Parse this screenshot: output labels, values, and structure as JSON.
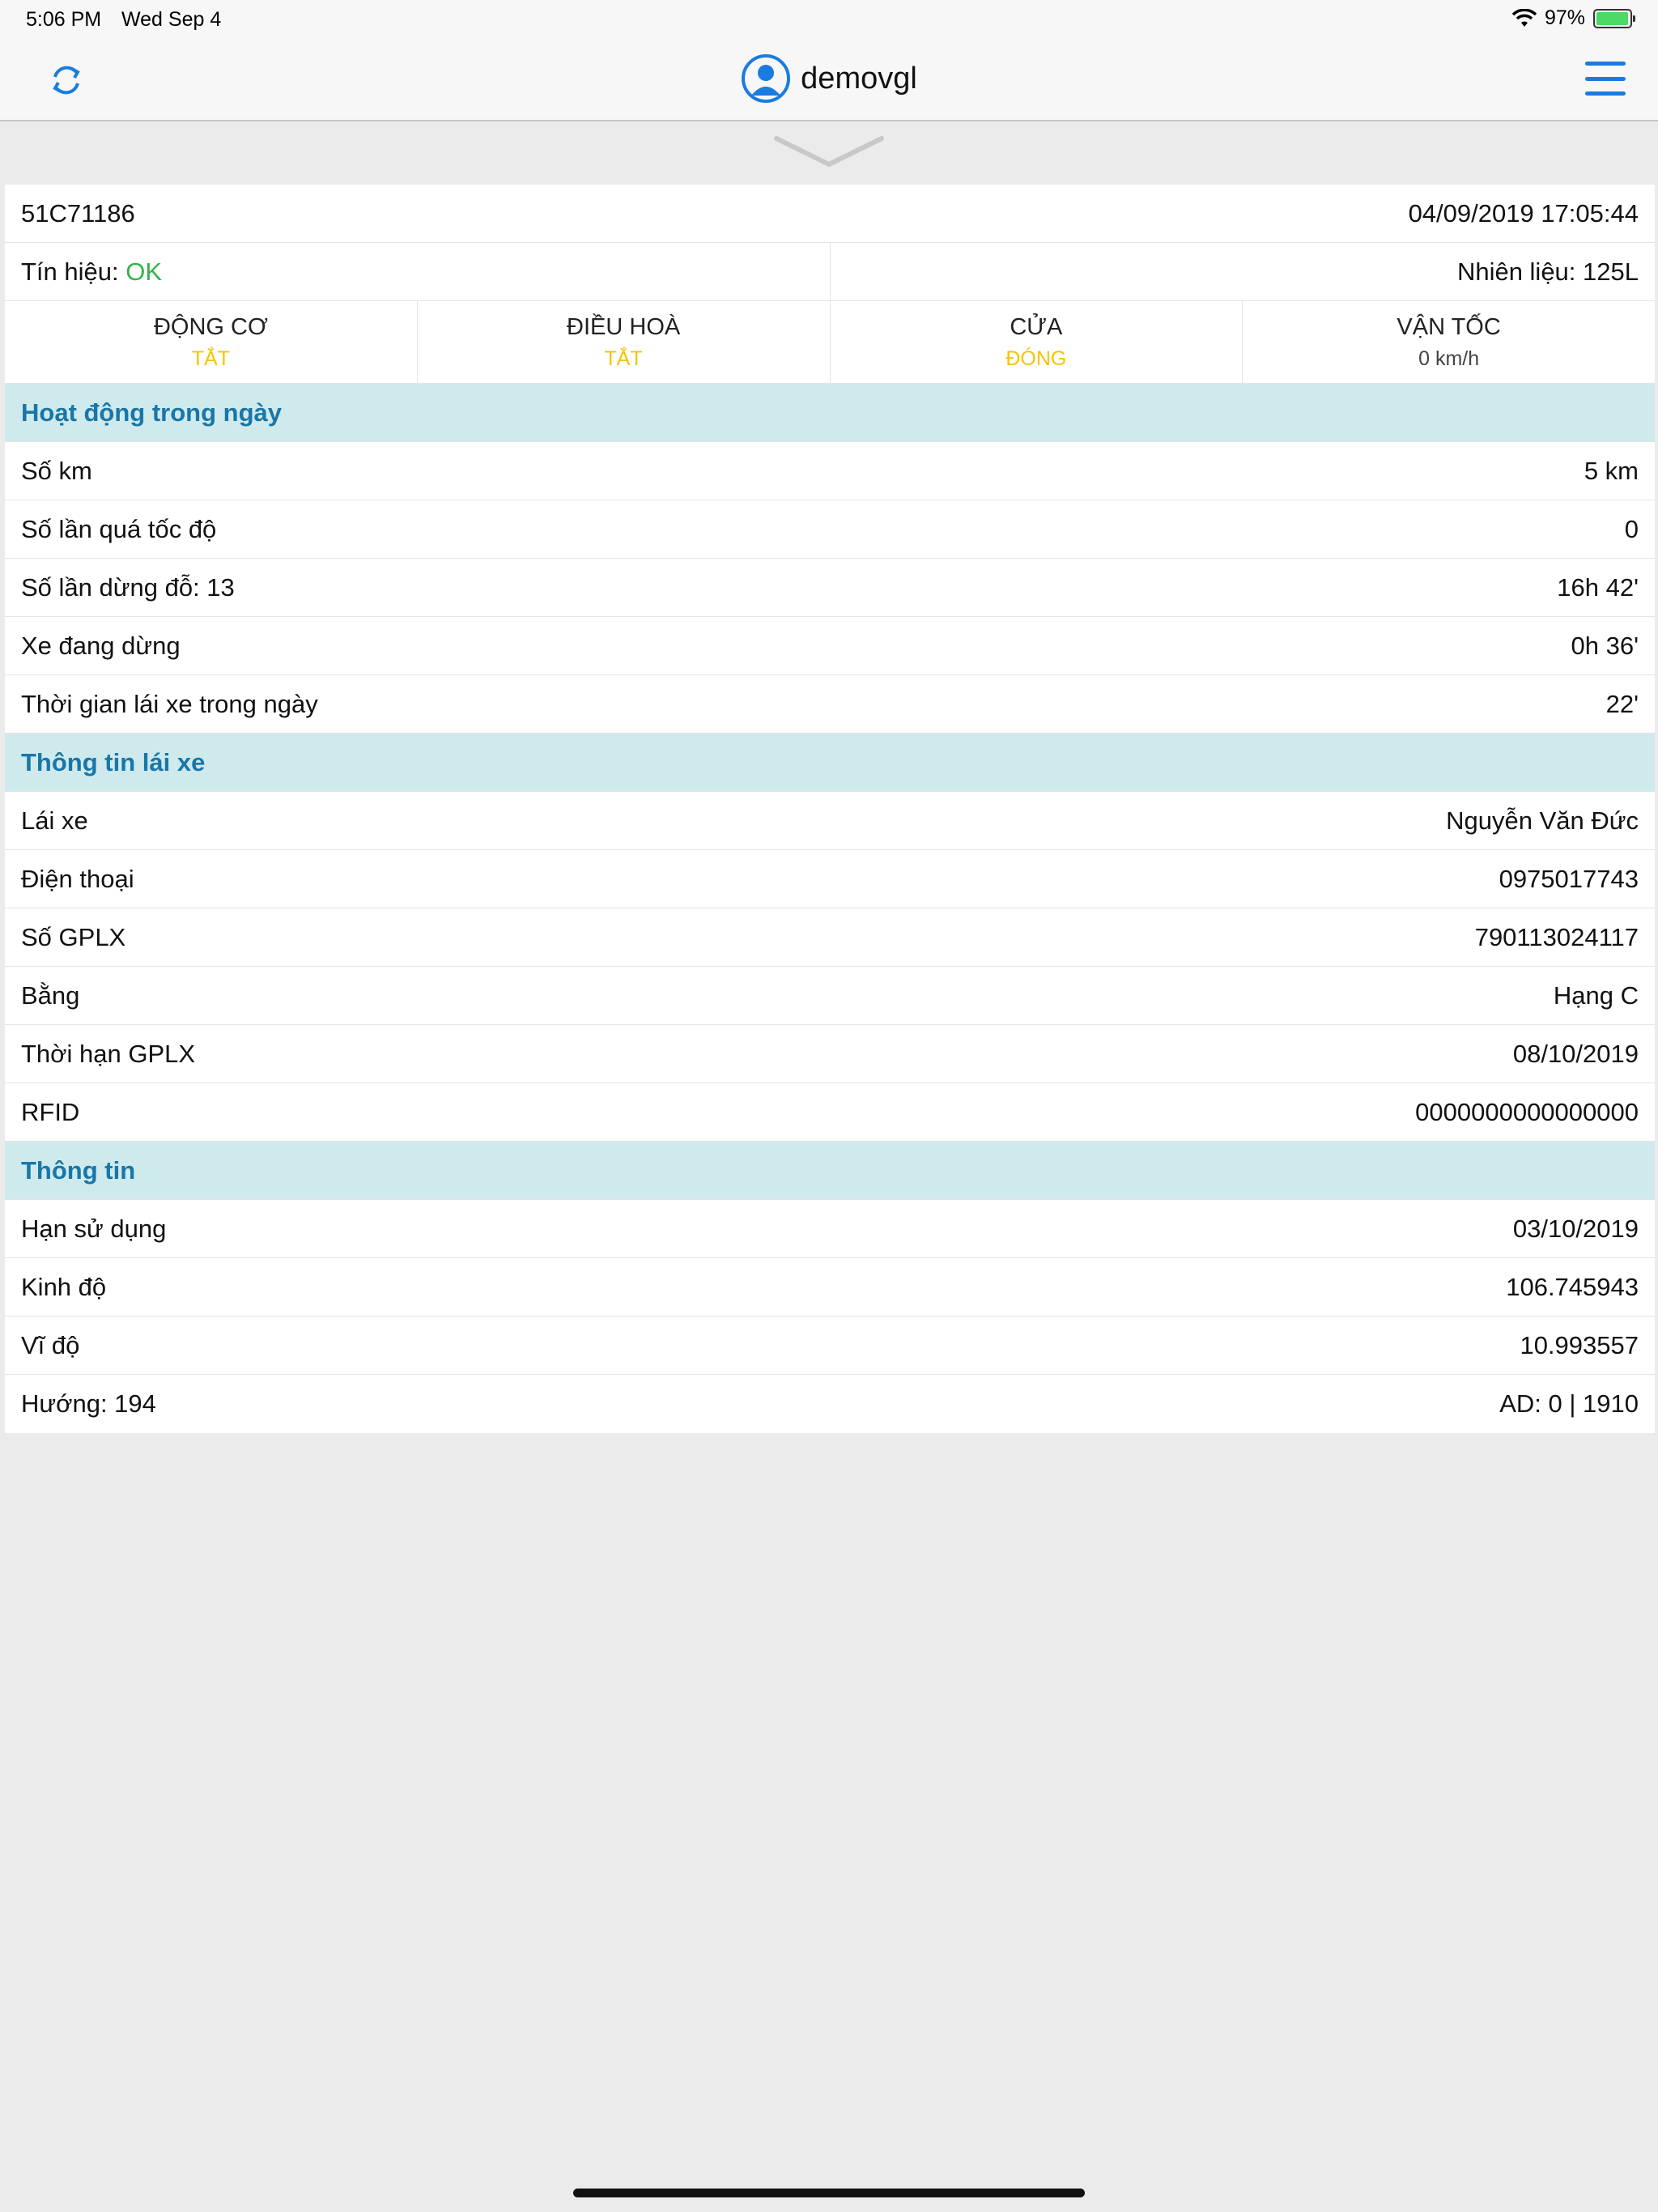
{
  "status_bar": {
    "time": "5:06 PM",
    "date": "Wed Sep 4",
    "battery": "97%",
    "battery_level": 0.97
  },
  "nav": {
    "username": "demovgl"
  },
  "vehicle": {
    "plate": "51C71186",
    "timestamp": "04/09/2019 17:05:44"
  },
  "signal": {
    "label": "Tín hiệu:",
    "value": "OK",
    "fuel": "Nhiên liệu: 125L"
  },
  "stats": [
    {
      "label": "ĐỘNG CƠ",
      "value": "TẮT"
    },
    {
      "label": "ĐIỀU HOÀ",
      "value": "TẮT"
    },
    {
      "label": "CỬA",
      "value": "ĐÓNG"
    },
    {
      "label": "VẬN TỐC",
      "value": "0 km/h"
    }
  ],
  "sections": {
    "activity": {
      "title": "Hoạt động trong ngày",
      "rows": [
        {
          "label": "Số km",
          "value": "5 km"
        },
        {
          "label": "Số lần quá tốc độ",
          "value": "0"
        },
        {
          "label": "Số lần dừng đỗ: 13",
          "value": "16h 42'"
        },
        {
          "label": "Xe đang dừng",
          "value": "0h 36'"
        },
        {
          "label": "Thời gian lái xe trong ngày",
          "value": "22'"
        }
      ]
    },
    "driver": {
      "title": "Thông tin lái xe",
      "rows": [
        {
          "label": "Lái xe",
          "value": "Nguyễn Văn Đức"
        },
        {
          "label": "Điện thoại",
          "value": "0975017743"
        },
        {
          "label": "Số GPLX",
          "value": "790113024117"
        },
        {
          "label": "Bằng",
          "value": "Hạng C"
        },
        {
          "label": "Thời hạn GPLX",
          "value": "08/10/2019"
        },
        {
          "label": "RFID",
          "value": "0000000000000000"
        }
      ]
    },
    "info": {
      "title": "Thông tin",
      "rows": [
        {
          "label": "Hạn sử dụng",
          "value": "03/10/2019"
        },
        {
          "label": "Kinh độ",
          "value": "106.745943"
        },
        {
          "label": "Vĩ độ",
          "value": "10.993557"
        },
        {
          "label": "Hướng: 194",
          "value": "AD: 0 | 1910"
        }
      ]
    }
  },
  "colors": {
    "accent": "#1a7be0",
    "section_bg": "#cfeaec",
    "section_text": "#1976a8",
    "ok": "#34b34a",
    "off": "#f5c400"
  }
}
